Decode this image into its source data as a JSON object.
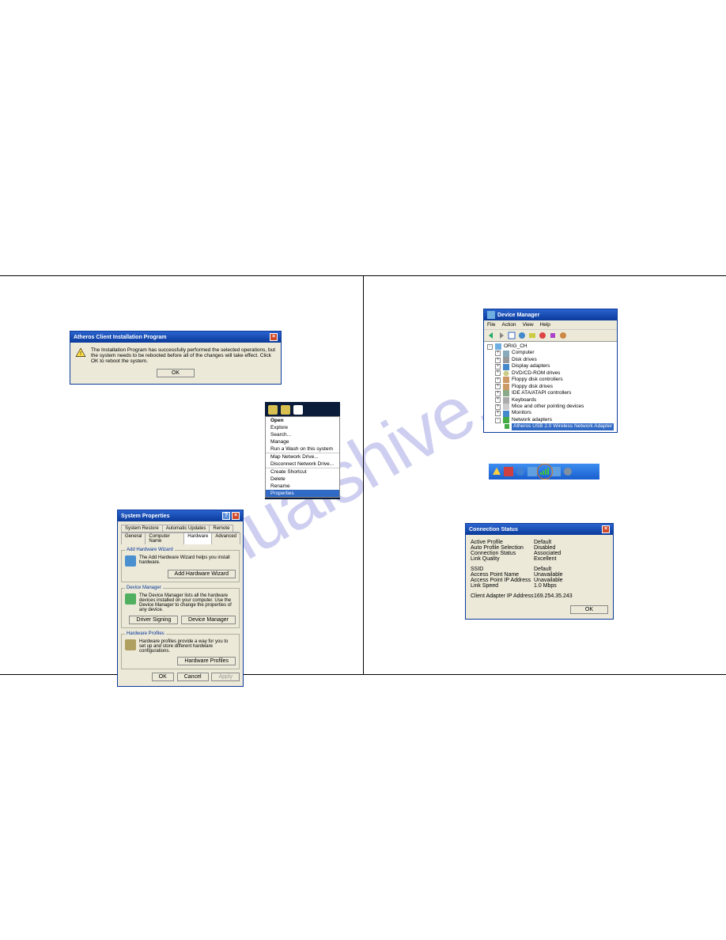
{
  "watermark": "manualshive.com",
  "installDialog": {
    "title": "Atheros Client Installation Program",
    "message": "The Installation Program has successfully performed the selected operations, but the system needs to be rebooted before all of the changes will take effect. Click OK to reboot the system.",
    "ok": "OK"
  },
  "contextMenu": {
    "items": [
      "Open",
      "Explore",
      "Search...",
      "Manage",
      "Run a Wash on this system"
    ],
    "items2": [
      "Map Network Drive...",
      "Disconnect Network Drive..."
    ],
    "items3": [
      "Create Shortcut",
      "Delete",
      "Rename"
    ],
    "selected": "Properties"
  },
  "sysProps": {
    "title": "System Properties",
    "tabsTop": [
      "System Restore",
      "Automatic Updates",
      "Remote"
    ],
    "tabsBottom": [
      "General",
      "Computer Name",
      "Hardware",
      "Advanced"
    ],
    "addHw": {
      "legend": "Add Hardware Wizard",
      "text": "The Add Hardware Wizard helps you install hardware.",
      "btn": "Add Hardware Wizard"
    },
    "devMgr": {
      "legend": "Device Manager",
      "text": "The Device Manager lists all the hardware devices installed on your computer. Use the Device Manager to change the properties of any device.",
      "btn1": "Driver Signing",
      "btn2": "Device Manager"
    },
    "hwProf": {
      "legend": "Hardware Profiles",
      "text": "Hardware profiles provide a way for you to set up and store different hardware configurations.",
      "btn": "Hardware Profiles"
    },
    "foot": {
      "ok": "OK",
      "cancel": "Cancel",
      "apply": "Apply"
    }
  },
  "deviceManager": {
    "title": "Device Manager",
    "menus": [
      "File",
      "Action",
      "View",
      "Help"
    ],
    "root": "ORIG_CH",
    "nodes": [
      "Computer",
      "Disk drives",
      "Display adapters",
      "DVD/CD-ROM drives",
      "Floppy disk controllers",
      "Floppy disk drives",
      "IDE ATA/ATAPI controllers",
      "Keyboards",
      "Mice and other pointing devices",
      "Monitors",
      "Network adapters"
    ],
    "selected": "Atheros USB 2.0 Wireless Network Adapter"
  },
  "connStatus": {
    "title": "Connection Status",
    "rows1": [
      {
        "k": "Active Profile",
        "v": "Default"
      },
      {
        "k": "Auto Profile Selection",
        "v": "Disabled"
      },
      {
        "k": "Connection Status",
        "v": "Associated"
      },
      {
        "k": "Link Quality",
        "v": "Excellent"
      }
    ],
    "rows2": [
      {
        "k": "SSID",
        "v": "Default"
      },
      {
        "k": "Access Point Name",
        "v": "Unavailable"
      },
      {
        "k": "Access Point IP Address",
        "v": "Unavailable"
      },
      {
        "k": "Link Speed",
        "v": "1.0 Mbps"
      }
    ],
    "rows3": [
      {
        "k": "Client Adapter IP Address",
        "v": "169.254.35.243"
      }
    ],
    "ok": "OK"
  }
}
